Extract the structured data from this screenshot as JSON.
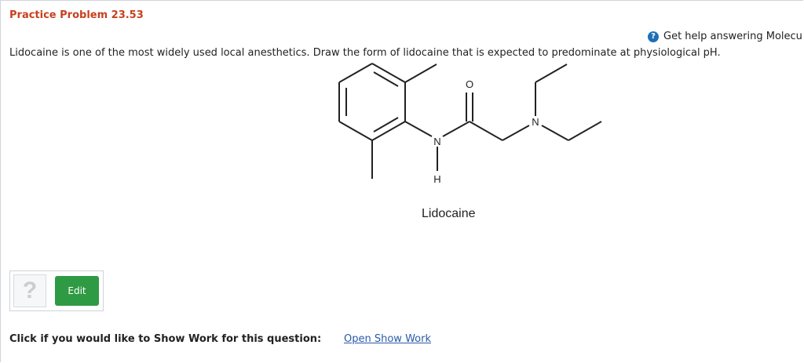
{
  "problem": {
    "title": "Practice Problem 23.53"
  },
  "help": {
    "icon": "help-circle-icon",
    "text": "Get help answering Molecu"
  },
  "question": {
    "text": "Lidocaine is one of the most widely used local anesthetics. Draw the form of lidocaine that is expected to predominate at physiological pH."
  },
  "molecule": {
    "caption": "Lidocaine",
    "atom_labels": {
      "oxygen": "O",
      "amide_nitrogen": "N",
      "amide_hydrogen": "H",
      "amine_nitrogen": "N"
    }
  },
  "toolbar": {
    "question_icon": "?",
    "edit_label": "Edit"
  },
  "show_work": {
    "prompt": "Click if you would like to Show Work for this question:",
    "link": "Open Show Work"
  }
}
